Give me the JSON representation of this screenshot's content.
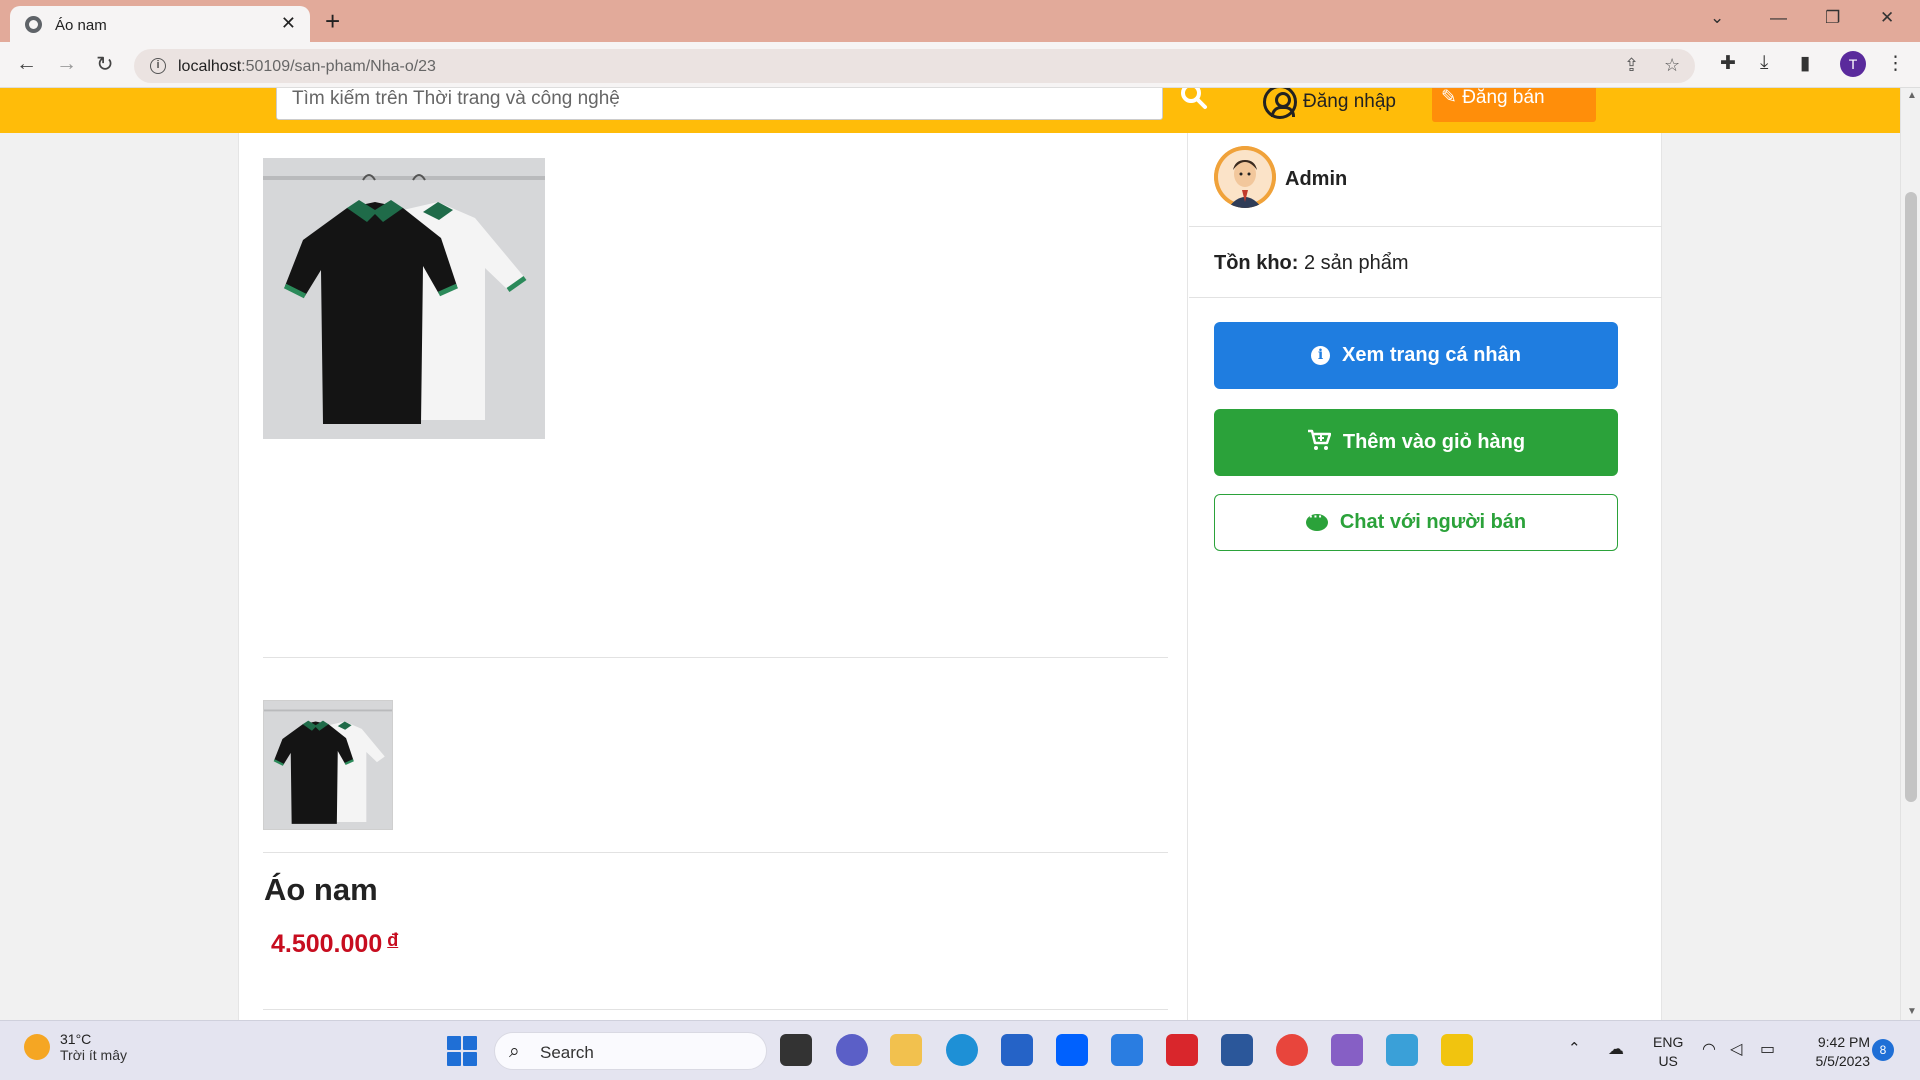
{
  "browser": {
    "tab_title": "Áo nam",
    "tab_close": "✕",
    "new_tab": "+",
    "url_host": "localhost",
    "url_path": ":50109/san-pham/Nha-o/23",
    "profile_initial": "T"
  },
  "header": {
    "search_placeholder": "Tìm kiếm trên Thời trang và công nghệ",
    "login_label": "Đăng nhập",
    "sell_label": "Đăng bán",
    "brand_color": "#ffbc09"
  },
  "product": {
    "name": "Áo nam",
    "price": "4.500.000",
    "currency": "đ"
  },
  "seller": {
    "name": "Admin",
    "stock_label": "Tồn kho:",
    "stock_value": "2 sản phẩm",
    "view_profile_label": "Xem trang cá nhân",
    "add_to_cart_label": "Thêm vào giỏ hàng",
    "chat_label": "Chat với người bán"
  },
  "colors": {
    "primary_blue": "#1f7de0",
    "success_green": "#2ba23a",
    "price_red": "#c70d1f"
  },
  "taskbar": {
    "weather_temp": "31°C",
    "weather_desc": "Trời ít mây",
    "search_label": "Search",
    "lang_line1": "ENG",
    "lang_line2": "US",
    "time": "9:42 PM",
    "date": "5/5/2023",
    "notification_count": "8"
  }
}
